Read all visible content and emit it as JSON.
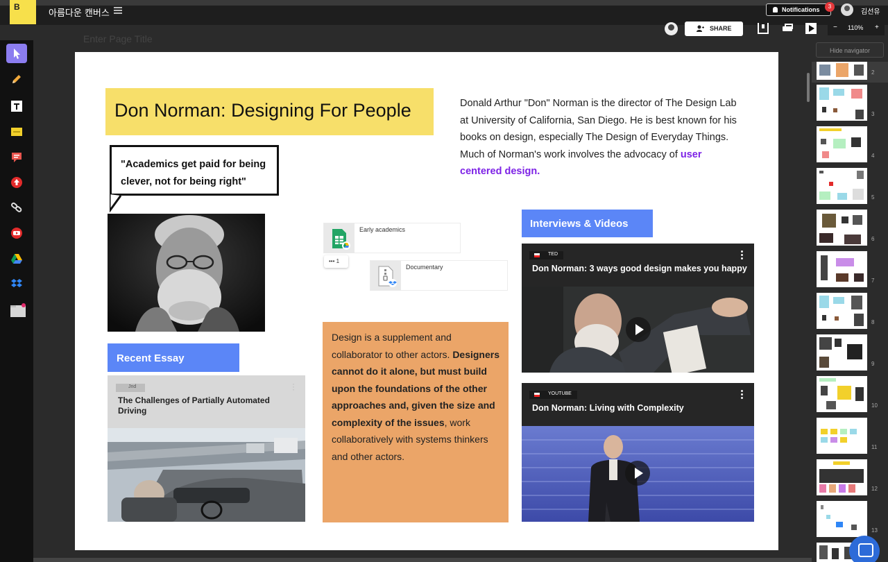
{
  "topbar": {
    "logo_letter": "B",
    "board_title": "아름다운 캔버스",
    "notifications_label": "Notifications",
    "notification_count": "3",
    "user_name": "김선유",
    "share_label": "SHARE",
    "zoom_out": "−",
    "zoom_level": "110%",
    "zoom_in": "+"
  },
  "canvas": {
    "page_title_placeholder": "Enter Page Title"
  },
  "page": {
    "title": "Don Norman: Designing For People",
    "bio_text": "Donald Arthur \"Don\" Norman is the director of The Design Lab at University of California, San Diego. He is best known for his books on design, especially The Design of Everyday Things. Much of Norman's work involves the advocacy of",
    "bio_link": "user centered design.",
    "quote": "\"Academics get paid for being clever, not for being right\"",
    "recent_essay_label": "Recent Essay",
    "essay": {
      "tag": "Jnd",
      "title": "The Challenges of Partially Automated Driving"
    },
    "files": [
      {
        "name": "Early academics"
      },
      {
        "name": "Documentary"
      }
    ],
    "comment_count": "1",
    "design_note": {
      "part1": "Design is a supplement and collaborator to other actors. ",
      "bold": "Designers cannot do it alone, but must build upon the foundations of the other approaches and, given the size and complexity of the issues",
      "part2": ", work collaboratively with systems thinkers and other actors."
    },
    "interviews_label": "Interviews & Videos",
    "videos": [
      {
        "source": "TED",
        "title": "Don Norman: 3 ways good design makes you happy"
      },
      {
        "source": "YOUTUBE",
        "title": "Don Norman: Living with Complexity"
      }
    ]
  },
  "navigator": {
    "hide_label": "Hide navigator",
    "page_numbers": [
      "2",
      "3",
      "4",
      "5",
      "6",
      "7",
      "8",
      "9",
      "10",
      "11",
      "12",
      "13"
    ]
  },
  "colors": {
    "title_yellow": "#f7df6a",
    "accent_blue": "#5b86f7",
    "note_orange": "#eba568",
    "link_purple": "#7d22e6",
    "select_tool": "#8c7df0"
  }
}
